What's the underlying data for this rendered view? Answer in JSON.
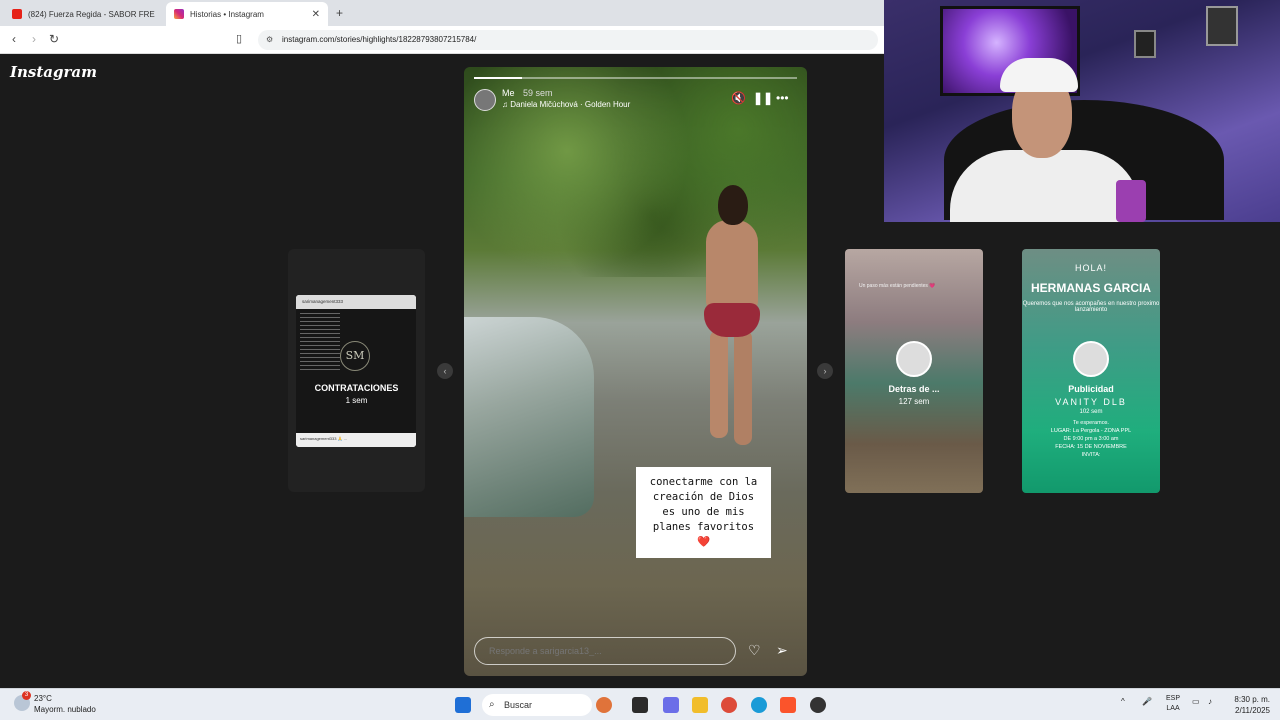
{
  "browser": {
    "tabs": [
      {
        "title": "(824) Fuerza Regida - SABOR FRE",
        "active": false
      },
      {
        "title": "Historias • Instagram",
        "active": true
      }
    ],
    "url": "instagram.com/stories/highlights/18228793807215784/"
  },
  "instagram": {
    "logo": "Instagram",
    "story": {
      "username": "Me",
      "time": "59 sem",
      "music": "Daniela Mičúchová · Golden Hour",
      "progress": 0.15,
      "caption_lines": [
        "conectarme con la",
        "creación de Dios",
        "es uno de mis",
        "planes favoritos"
      ],
      "caption_emoji": "❤️",
      "reply_placeholder": "Responde a sarigarcia13_..."
    },
    "prev_highlight": {
      "title": "CONTRATACIONES",
      "time": "1 sem",
      "card_header": "sarimanagement333",
      "card_mono": "SM",
      "card_footer": "sarimanagement333 🙏 ..."
    },
    "next_highlights": [
      {
        "title": "Detras de ...",
        "time": "127 sem",
        "overlay": "Un paso más están pendientes 💗"
      },
      {
        "title": "Publicidad",
        "time": "102 sem",
        "hola": "HOLA!",
        "heading": "HERMANAS GARCIA",
        "sub": "Queremos que nos acompañes en nuestro proximo lanzamiento",
        "brand": "VANITY DLB",
        "info": [
          "Te esperamos.",
          "LUGAR: La Pergola - ZONA PPL",
          "DE 9:00 pm a 3:00 am",
          "FECHA: 15 DE NOVIEMBRE",
          "INVITA:"
        ]
      }
    ]
  },
  "taskbar": {
    "weather_temp": "23°C",
    "weather_desc": "Mayorm. nublado",
    "weather_badge": "3",
    "search": "Buscar",
    "lang": [
      "ESP",
      "LAA"
    ],
    "time": "8:30 p. m.",
    "date": "2/11/2025"
  }
}
